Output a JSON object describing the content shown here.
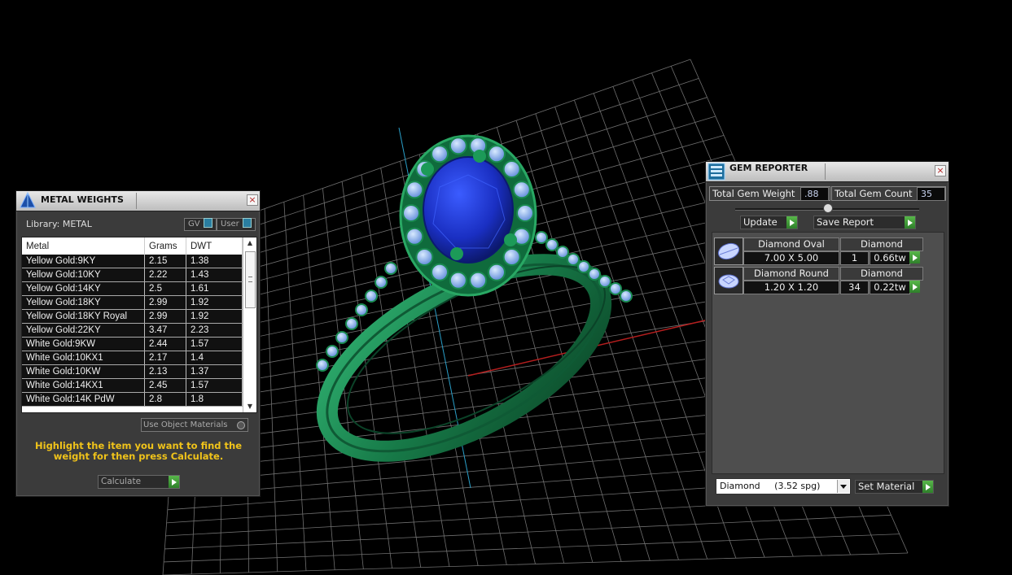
{
  "metal_weights": {
    "title": "METAL WEIGHTS",
    "library_label": "Library: METAL",
    "toggle_gv": "GV",
    "toggle_user": "User",
    "columns": [
      "Metal",
      "Grams",
      "DWT"
    ],
    "rows": [
      [
        "Yellow Gold:9KY",
        "2.15",
        "1.38"
      ],
      [
        "Yellow Gold:10KY",
        "2.22",
        "1.43"
      ],
      [
        "Yellow Gold:14KY",
        "2.5",
        "1.61"
      ],
      [
        "Yellow Gold:18KY",
        "2.99",
        "1.92"
      ],
      [
        "Yellow Gold:18KY Royal",
        "2.99",
        "1.92"
      ],
      [
        "Yellow Gold:22KY",
        "3.47",
        "2.23"
      ],
      [
        "White Gold:9KW",
        "2.44",
        "1.57"
      ],
      [
        "White Gold:10KX1",
        "2.17",
        "1.4"
      ],
      [
        "White Gold:10KW",
        "2.13",
        "1.37"
      ],
      [
        "White Gold:14KX1",
        "2.45",
        "1.57"
      ],
      [
        "White Gold:14K PdW",
        "2.8",
        "1.8"
      ]
    ],
    "use_object_materials": "Use Object Materials",
    "hint": "Highlight the item you want to find the weight for then press Calculate.",
    "calculate_label": "Calculate"
  },
  "gem_reporter": {
    "title": "GEM REPORTER",
    "total_weight_label": "Total Gem Weight",
    "total_weight_value": ".88",
    "total_count_label": "Total Gem Count",
    "total_count_value": "35",
    "update_label": "Update",
    "save_report_label": "Save Report",
    "gems": [
      {
        "shape": "Diamond Oval",
        "material": "Diamond",
        "size": "7.00 X 5.00",
        "count": "1",
        "weight": "0.66tw"
      },
      {
        "shape": "Diamond Round",
        "material": "Diamond",
        "size": "1.20 X 1.20",
        "count": "34",
        "weight": "0.22tw"
      }
    ],
    "material_select": "Diamond     (3.52 spg)",
    "set_material_label": "Set Material"
  },
  "colors": {
    "ring_metal": "#1f8a5a",
    "gem_center": "#1f3fd0",
    "gem_halo": "#8fb8f0",
    "grid": "#6f6f6f"
  }
}
